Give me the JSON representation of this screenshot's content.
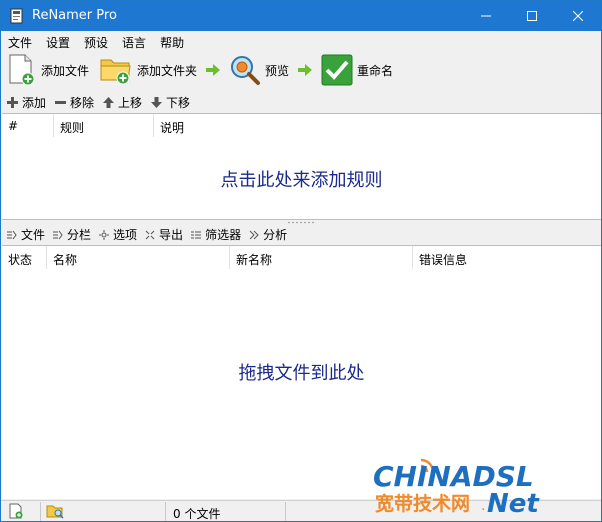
{
  "window": {
    "title": "ReNamer Pro"
  },
  "menu": {
    "items": [
      "文件",
      "设置",
      "预设",
      "语言",
      "帮助"
    ]
  },
  "toolbar": {
    "add_files": "添加文件",
    "add_folder": "添加文件夹",
    "preview": "预览",
    "rename": "重命名"
  },
  "rules_toolbar": {
    "add": "添加",
    "remove": "移除",
    "up": "上移",
    "down": "下移"
  },
  "rules_table": {
    "columns": [
      "#",
      "规则",
      "说明"
    ],
    "hint": "点击此处来添加规则"
  },
  "files_toolbar": {
    "files": "文件",
    "columns": "分栏",
    "options": "选项",
    "export": "导出",
    "filter": "筛选器",
    "analyze": "分析"
  },
  "files_table": {
    "columns": [
      "状态",
      "名称",
      "新名称",
      "错误信息"
    ],
    "hint": "拖拽文件到此处"
  },
  "status": {
    "count": "0 个文件"
  },
  "watermark": {
    "logo": "CHINADSL",
    "subtitle": "宽带技术网",
    "suffix": ".Net"
  },
  "colors": {
    "titlebar": "#1e78d2",
    "hint": "#1a2a8c",
    "check_green": "#3aa23a"
  }
}
